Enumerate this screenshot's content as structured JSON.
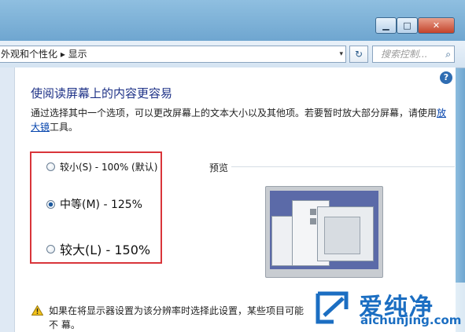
{
  "window": {
    "minimize": "▁",
    "maximize": "□",
    "close": "✕"
  },
  "address": {
    "breadcrumb": "外观和个性化 ▸ 显示",
    "dropdown": "▾",
    "refresh": "↻",
    "search_placeholder": "搜索控制...",
    "search_icon": "⌕"
  },
  "help_icon": "?",
  "main": {
    "heading": "使阅读屏幕上的内容更容易",
    "description_pre": "通过选择其中一个选项，可以更改屏幕上的文本大小以及其他项。若要暂时放大部分屏幕，请使用",
    "magnifier_link": "放大镜",
    "description_post": "工具。"
  },
  "options": [
    {
      "label": "较小(S) - 100% (默认)",
      "selected": false
    },
    {
      "label": "中等(M) - 125%",
      "selected": true
    },
    {
      "label": "较大(L) - 150%",
      "selected": false
    }
  ],
  "preview": {
    "label": "预览"
  },
  "warning": {
    "text": "如果在将显示器设置为该分辨率时选择此设置，某些项目可能不 幕。"
  },
  "watermark": {
    "brand": "爱纯净",
    "url": "aichunjing.com"
  },
  "colors": {
    "highlight_border": "#d9353a",
    "heading": "#1e3287",
    "link": "#0645ad"
  }
}
